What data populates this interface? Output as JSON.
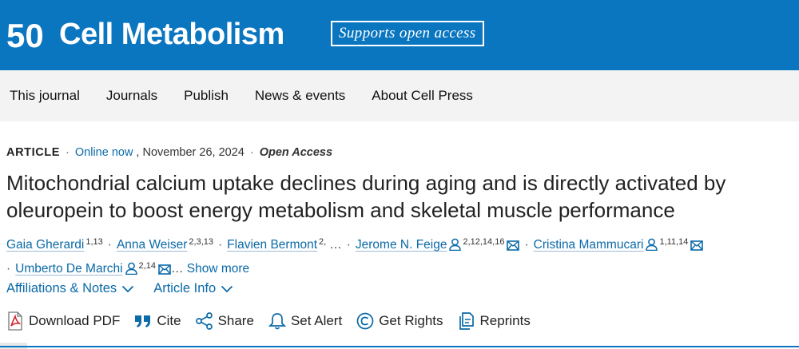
{
  "header": {
    "logo_number": "50",
    "journal_name": "Cell Metabolism",
    "badge": "Supports open access",
    "brand_color": "#0b76c0"
  },
  "nav": {
    "items": [
      "This journal",
      "Journals",
      "Publish",
      "News & events",
      "About Cell Press"
    ]
  },
  "article": {
    "type": "ARTICLE",
    "online_label": "Online now",
    "date": ", November 26, 2024",
    "access": "Open Access",
    "title": "Mitochondrial calcium uptake declines during aging and is directly activated by oleuropein to boost energy metabolism and skeletal muscle performance",
    "authors": [
      {
        "name": "Gaia Gherardi",
        "aff": "1,13"
      },
      {
        "name": "Anna Weiser",
        "aff": "2,3,13"
      },
      {
        "name": "Flavien Bermont",
        "aff": "2,"
      },
      {
        "name": "Jerome N. Feige",
        "aff": "2,12,14,16"
      },
      {
        "name": "Cristina Mammucari",
        "aff": "1,11,14"
      },
      {
        "name": "Umberto De Marchi",
        "aff": "2,14"
      }
    ],
    "ellipsis": "…",
    "trailing_ellipsis": "…",
    "show_more": "Show more",
    "affiliations_label": "Affiliations & Notes",
    "article_info_label": "Article Info"
  },
  "actions": {
    "download_pdf": "Download PDF",
    "cite": "Cite",
    "share": "Share",
    "set_alert": "Set Alert",
    "get_rights": "Get Rights",
    "reprints": "Reprints"
  },
  "icons": [
    "pdf-icon",
    "quote-icon",
    "share-icon",
    "bell-icon",
    "copyright-icon",
    "reprints-icon",
    "person-icon",
    "mail-icon",
    "chevron-down-icon"
  ]
}
